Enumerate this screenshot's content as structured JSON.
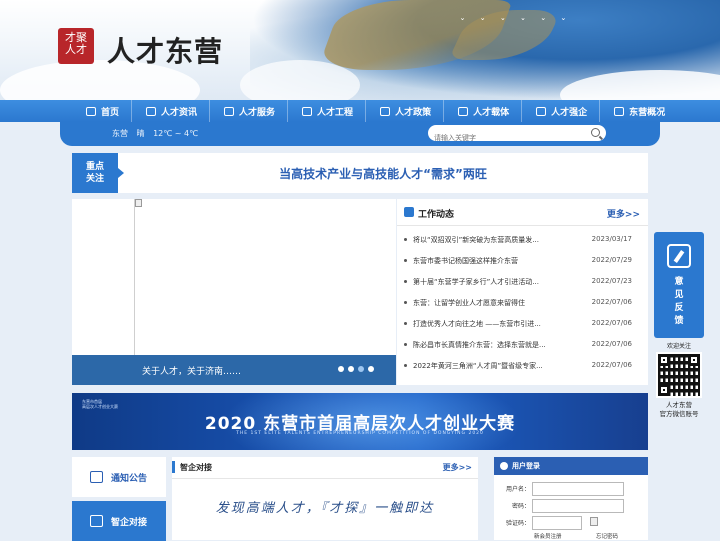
{
  "header": {
    "logo_seal_text": "才聚 人才",
    "site_title": "人才东营"
  },
  "nav": {
    "items": [
      {
        "label": "首页",
        "icon": "home-icon"
      },
      {
        "label": "人才资讯",
        "icon": "news-icon"
      },
      {
        "label": "人才服务",
        "icon": "service-icon"
      },
      {
        "label": "人才工程",
        "icon": "project-icon"
      },
      {
        "label": "人才政策",
        "icon": "policy-icon"
      },
      {
        "label": "人才载体",
        "icon": "carrier-icon"
      },
      {
        "label": "人才强企",
        "icon": "enterprise-icon"
      },
      {
        "label": "东营概况",
        "icon": "overview-icon"
      }
    ]
  },
  "infobar": {
    "city": "东营",
    "weather": "晴",
    "temperature": "12℃ ~ 4℃",
    "search_placeholder": "请输入关键字"
  },
  "focus": {
    "badge_line1": "重点",
    "badge_line2": "关注",
    "headline": "当高技术产业与高技能人才“需求”两旺"
  },
  "slider": {
    "caption": "关于人才，关于济南……",
    "dot_count": 4,
    "active_dot": 3
  },
  "news": {
    "title": "工作动态",
    "more": "更多>>",
    "items": [
      {
        "title": "将以“双招双引”新突破为东营高质量发...",
        "date": "2023/03/17"
      },
      {
        "title": "东营市委书记杨国强这样推介东营",
        "date": "2022/07/29"
      },
      {
        "title": "第十届“东营学子家乡行”人才引进活动...",
        "date": "2022/07/23"
      },
      {
        "title": "东营：让留学创业人才愿意来留得住",
        "date": "2022/07/06"
      },
      {
        "title": "打造优秀人才向往之地 ——东营市引进...",
        "date": "2022/07/06"
      },
      {
        "title": "陈必昌市长真情推介东营：选择东营就是...",
        "date": "2022/07/06"
      },
      {
        "title": "2022年黄河三角洲“人才周”暨省级专家...",
        "date": "2022/07/06"
      }
    ]
  },
  "banner": {
    "logo_line1": "东营市首届",
    "logo_line2": "高层次人才创业大赛",
    "title": "2020 东营市首届高层次人才创业大赛",
    "subtitle": "THE 1ST ELITE TALENTS ENTREPRENEURSHIP COMPETITION OF DONGYING 2020"
  },
  "tabs": {
    "notice": "通知公告",
    "talent": "智企对接"
  },
  "connect": {
    "title": "智企对接",
    "more": "更多>>",
    "slogan": "发现高端人才，『才探』一触即达"
  },
  "login": {
    "title": "用户登录",
    "username_label": "用户名：",
    "password_label": "密码：",
    "captcha_label": "验证码：",
    "register": "新会员注册",
    "forgot": "忘记密码"
  },
  "feedback": {
    "label": "意见反馈"
  },
  "qr": {
    "title": "欢迎关注",
    "caption_line1": "人才东营",
    "caption_line2": "官方微信账号"
  },
  "colors": {
    "primary": "#2b78cf",
    "nav": "#3d8ee0",
    "headline": "#2b5fb3",
    "banner": "#1a56b8"
  }
}
